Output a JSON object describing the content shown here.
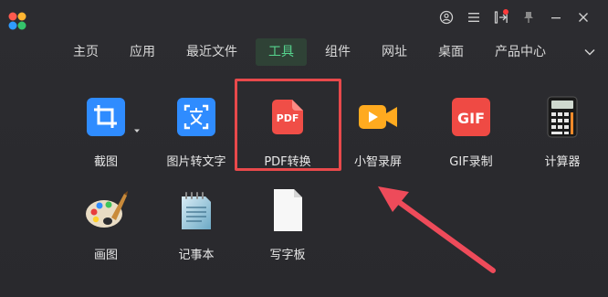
{
  "window": {
    "controls": [
      {
        "name": "user-icon"
      },
      {
        "name": "menu-icon"
      },
      {
        "name": "side-panel-icon"
      },
      {
        "name": "pin-icon"
      },
      {
        "name": "minimize-icon"
      },
      {
        "name": "close-icon"
      }
    ]
  },
  "nav": {
    "tabs": [
      {
        "label": "主页",
        "active": false
      },
      {
        "label": "应用",
        "active": false
      },
      {
        "label": "最近文件",
        "active": false
      },
      {
        "label": "工具",
        "active": true
      },
      {
        "label": "组件",
        "active": false
      },
      {
        "label": "网址",
        "active": false
      },
      {
        "label": "桌面",
        "active": false
      },
      {
        "label": "产品中心",
        "active": false
      }
    ]
  },
  "tools": [
    {
      "label": "截图",
      "icon": "crop-icon"
    },
    {
      "label": "图片转文字",
      "icon": "image-to-text-icon"
    },
    {
      "label": "PDF转换",
      "icon": "pdf-convert-icon",
      "icon_text": "PDF"
    },
    {
      "label": "小智录屏",
      "icon": "screen-record-icon"
    },
    {
      "label": "GIF录制",
      "icon": "gif-record-icon",
      "icon_text": "GIF"
    },
    {
      "label": "计算器",
      "icon": "calculator-icon"
    },
    {
      "label": "画图",
      "icon": "paint-palette-icon"
    },
    {
      "label": "记事本",
      "icon": "notepad-icon"
    },
    {
      "label": "写字板",
      "icon": "wordpad-icon"
    }
  ],
  "colors": {
    "accent": "#56d38d",
    "highlight": "#e8494b",
    "background": "#2b2b2f"
  }
}
